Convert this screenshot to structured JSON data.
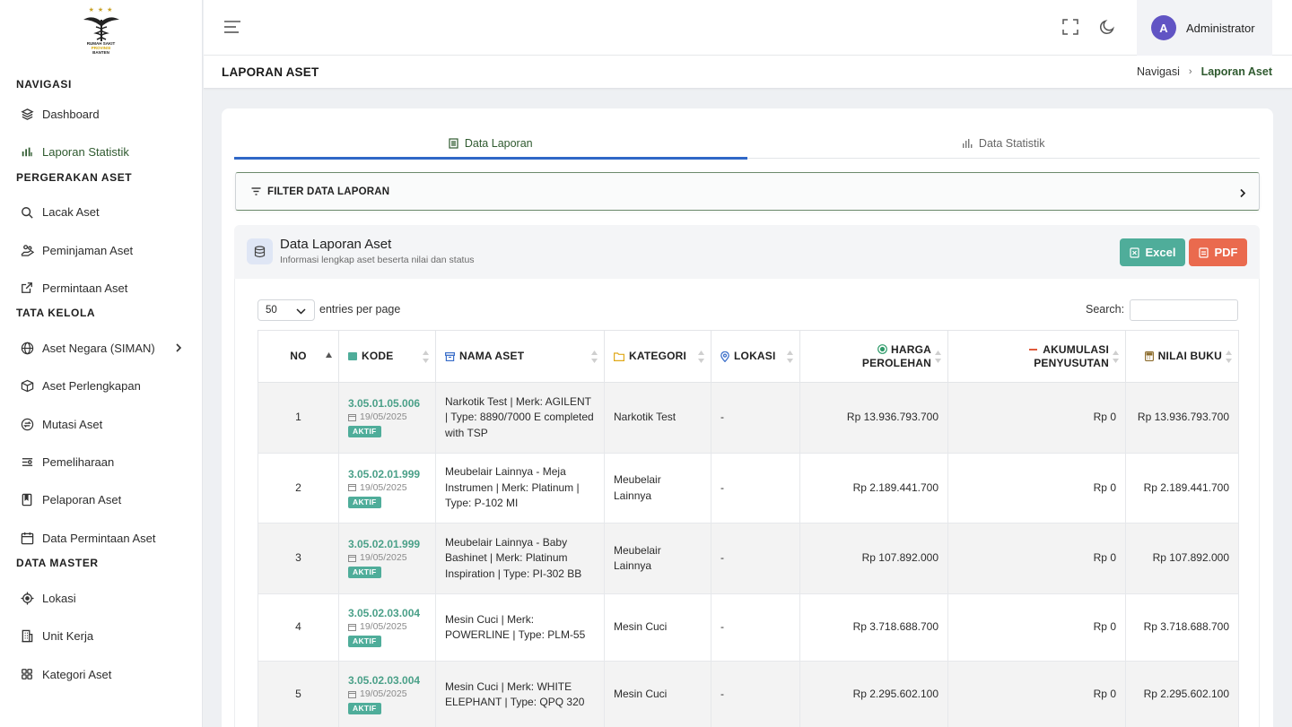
{
  "sidebar": {
    "logo": {
      "line1": "RUMAH SAKIT",
      "line2": "PROVINSI",
      "line3": "BANTEN"
    },
    "sections": [
      {
        "title": "NAVIGASI",
        "items": [
          {
            "label": "Dashboard",
            "icon": "layers-icon"
          },
          {
            "label": "Laporan Statistik",
            "icon": "bar-chart-icon",
            "active": true
          }
        ]
      },
      {
        "title": "PERGERAKAN ASET",
        "items": [
          {
            "label": "Lacak Aset",
            "icon": "search-icon"
          },
          {
            "label": "Peminjaman Aset",
            "icon": "hand-icon"
          },
          {
            "label": "Permintaan Aset",
            "icon": "external-link-icon"
          }
        ]
      },
      {
        "title": "TATA KELOLA",
        "items": [
          {
            "label": "Aset Negara (SIMAN)",
            "icon": "globe-icon",
            "has_submenu": true
          },
          {
            "label": "Aset Perlengkapan",
            "icon": "box-icon"
          },
          {
            "label": "Mutasi Aset",
            "icon": "exchange-icon"
          },
          {
            "label": "Pemeliharaan",
            "icon": "sliders-icon"
          },
          {
            "label": "Pelaporan Aset",
            "icon": "book-icon"
          },
          {
            "label": "Data Permintaan Aset",
            "icon": "calendar-icon"
          }
        ]
      },
      {
        "title": "DATA MASTER",
        "items": [
          {
            "label": "Lokasi",
            "icon": "target-icon"
          },
          {
            "label": "Unit Kerja",
            "icon": "building-icon"
          },
          {
            "label": "Kategori Aset",
            "icon": "grid-icon"
          }
        ]
      }
    ]
  },
  "header": {
    "user_initial": "A",
    "user_name": "Administrator"
  },
  "breadcrumb": {
    "page_title": "LAPORAN ASET",
    "root": "Navigasi",
    "current": "Laporan Aset"
  },
  "tabs": [
    {
      "label": "Data Laporan",
      "active": true
    },
    {
      "label": "Data Statistik",
      "active": false
    }
  ],
  "filter": {
    "label": "FILTER DATA LAPORAN"
  },
  "report": {
    "title": "Data Laporan Aset",
    "subtitle": "Informasi lengkap aset beserta nilai dan status",
    "excel_label": "Excel",
    "pdf_label": "PDF",
    "page_length": "50",
    "page_length_suffix": "entries per page",
    "search_label": "Search:",
    "search_value": ""
  },
  "table": {
    "columns": {
      "no": "NO",
      "kode": "KODE",
      "nama": "NAMA ASET",
      "kategori": "KATEGORI",
      "lokasi": "LOKASI",
      "harga_1": "HARGA",
      "harga_2": "PEROLEHAN",
      "akum_1": "AKUMULASI",
      "akum_2": "PENYUSUTAN",
      "nilai": "NILAI BUKU"
    },
    "rows": [
      {
        "no": "1",
        "kode": "3.05.01.05.006",
        "tanggal": "19/05/2025",
        "status": "AKTIF",
        "nama": "Narkotik Test | Merk: AGILENT | Type: 8890/7000 E completed with TSP",
        "kategori": "Narkotik Test",
        "lokasi": "-",
        "harga": "Rp 13.936.793.700",
        "akumulasi": "Rp 0",
        "nilai": "Rp 13.936.793.700"
      },
      {
        "no": "2",
        "kode": "3.05.02.01.999",
        "tanggal": "19/05/2025",
        "status": "AKTIF",
        "nama": "Meubelair Lainnya - Meja Instrumen | Merk: Platinum | Type: P-102 MI",
        "kategori": "Meubelair Lainnya",
        "lokasi": "-",
        "harga": "Rp 2.189.441.700",
        "akumulasi": "Rp 0",
        "nilai": "Rp 2.189.441.700"
      },
      {
        "no": "3",
        "kode": "3.05.02.01.999",
        "tanggal": "19/05/2025",
        "status": "AKTIF",
        "nama": "Meubelair Lainnya - Baby Bashinet | Merk: Platinum Inspiration | Type: PI-302 BB",
        "kategori": "Meubelair Lainnya",
        "lokasi": "-",
        "harga": "Rp 107.892.000",
        "akumulasi": "Rp 0",
        "nilai": "Rp 107.892.000"
      },
      {
        "no": "4",
        "kode": "3.05.02.03.004",
        "tanggal": "19/05/2025",
        "status": "AKTIF",
        "nama": "Mesin Cuci | Merk: POWERLINE | Type: PLM-55",
        "kategori": "Mesin Cuci",
        "lokasi": "-",
        "harga": "Rp 3.718.688.700",
        "akumulasi": "Rp 0",
        "nilai": "Rp 3.718.688.700"
      },
      {
        "no": "5",
        "kode": "3.05.02.03.004",
        "tanggal": "19/05/2025",
        "status": "AKTIF",
        "nama": "Mesin Cuci | Merk: WHITE ELEPHANT | Type: QPQ 320",
        "kategori": "Mesin Cuci",
        "lokasi": "-",
        "harga": "Rp 2.295.602.100",
        "akumulasi": "Rp 0",
        "nilai": "Rp 2.295.602.100"
      }
    ]
  },
  "colors": {
    "accent_green": "#2f5a2f",
    "teal": "#4fad9a",
    "pdf_red": "#ea6a4e",
    "tab_underline": "#2f67c7",
    "avatar": "#6154c4"
  }
}
